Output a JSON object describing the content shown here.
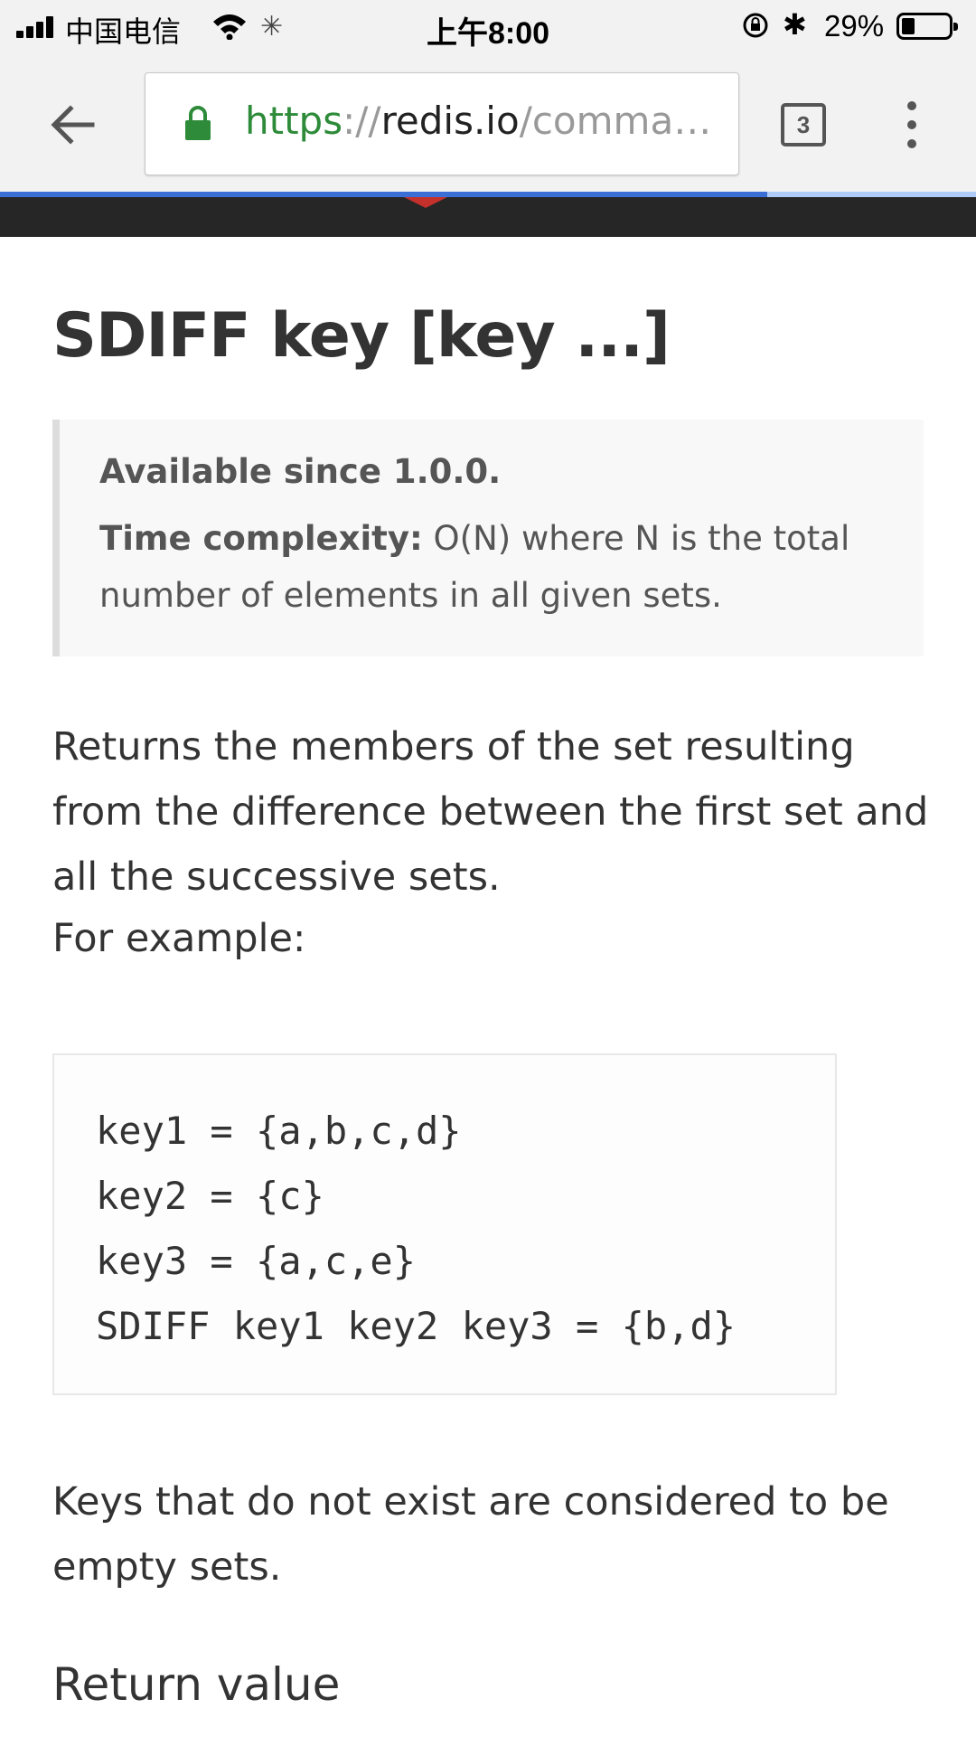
{
  "status_bar": {
    "carrier": "中国电信",
    "time": "上午8:00",
    "battery_percent": "29%",
    "battery_level": 0.29,
    "icons": [
      "signal-icon",
      "wifi-icon",
      "loading-icon",
      "rotation-lock-icon",
      "bluetooth-icon",
      "battery-icon"
    ]
  },
  "browser": {
    "url_scheme": "https",
    "url_separator": "://",
    "url_host": "redis.io",
    "url_path": "/comman…",
    "tab_count": "3",
    "page_load_progress": 0.786,
    "icons": [
      "back-arrow-icon",
      "lock-icon",
      "tabs-icon",
      "overflow-menu-icon"
    ],
    "colors": {
      "secure": "#2e8b3a",
      "progress": "#3b6fd6"
    }
  },
  "site_header": {
    "background": "#262626",
    "accent": "#c4302b"
  },
  "page": {
    "title": "SDIFF key [key ...]",
    "available_since": "Available since 1.0.0.",
    "time_complexity_label": "Time complexity:",
    "time_complexity_value": " O(N) where N is the total number of elements in all given sets.",
    "description": "Returns the members of the set resulting from the difference between the first set and all the successive sets.",
    "example_intro": "For example:",
    "code_lines": [
      "key1 = {a,b,c,d}",
      "key2 = {c}",
      "key3 = {a,c,e}",
      "SDIFF key1 key2 key3 = {b,d}"
    ],
    "note": "Keys that do not exist are considered to be empty sets.",
    "section_heading": "Return value"
  }
}
